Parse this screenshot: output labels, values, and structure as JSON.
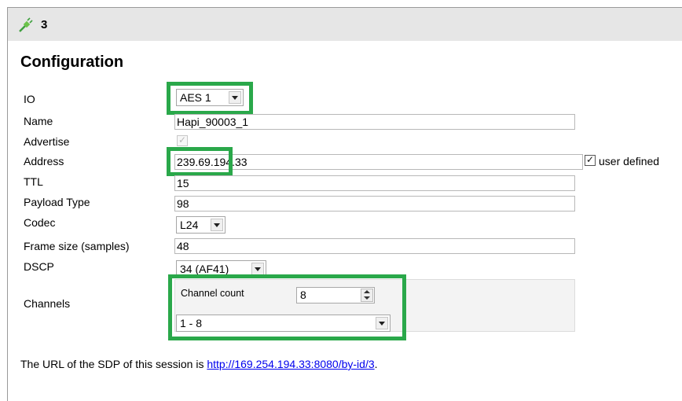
{
  "title": {
    "number": "3"
  },
  "heading": "Configuration",
  "fields": {
    "io": {
      "label": "IO",
      "value": "AES 1"
    },
    "name": {
      "label": "Name",
      "value": "Hapi_90003_1"
    },
    "advertise": {
      "label": "Advertise",
      "checked": true,
      "disabled": true
    },
    "address": {
      "label": "Address",
      "value": "239.69.194.33",
      "user_defined_label": "user defined",
      "user_defined_checked": true
    },
    "ttl": {
      "label": "TTL",
      "value": "15"
    },
    "payload_type": {
      "label": "Payload Type",
      "value": "98"
    },
    "codec": {
      "label": "Codec",
      "value": "L24"
    },
    "frame_size": {
      "label": "Frame size (samples)",
      "value": "48"
    },
    "dscp": {
      "label": "DSCP",
      "value": "34 (AF41)"
    },
    "channels": {
      "label": "Channels",
      "count_label": "Channel count",
      "count_value": "8",
      "range_value": "1 - 8"
    }
  },
  "footer": {
    "text": "The URL of the SDP of this session is ",
    "link": "http://169.254.194.33:8080/by-id/3",
    "suffix": "."
  },
  "colors": {
    "highlight": "#2aa84a",
    "titlebar": "#e6e6e6",
    "link": "#0000ee"
  },
  "icons": {
    "title": "plug-icon"
  }
}
